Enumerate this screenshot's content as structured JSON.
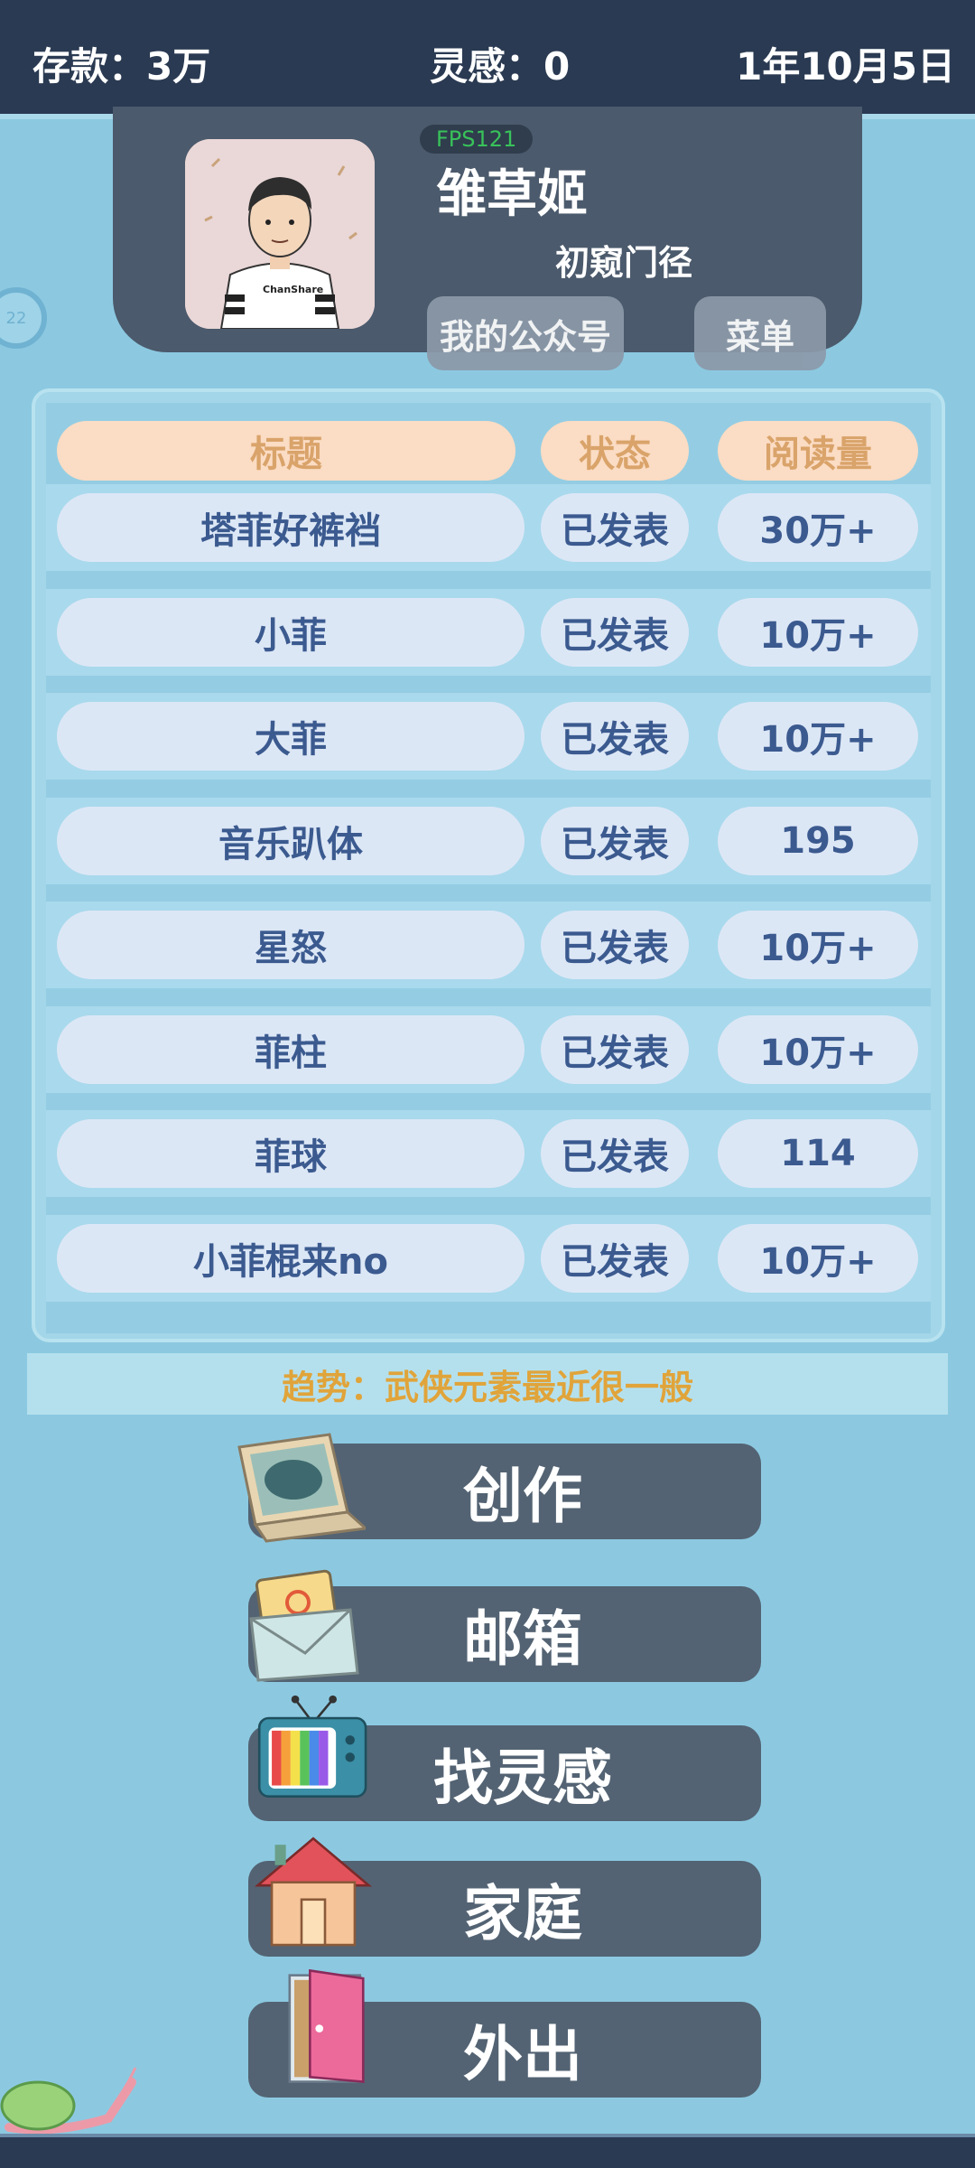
{
  "topbar": {
    "savings": "存款：3万",
    "inspiration": "灵感：0",
    "date": "1年10月5日"
  },
  "profile": {
    "fps": "FPS121",
    "name": "雏草姬",
    "level": "初窥门径",
    "avatar_shirt_text": "ChanShare",
    "buttons": {
      "account": "我的公众号",
      "menu": "菜单"
    }
  },
  "side_badge": "22",
  "table": {
    "headers": [
      "标题",
      "状态",
      "阅读量"
    ],
    "rows": [
      {
        "title": "塔菲好裤裆",
        "status": "已发表",
        "reads": "30万+"
      },
      {
        "title": "小菲",
        "status": "已发表",
        "reads": "10万+"
      },
      {
        "title": "大菲",
        "status": "已发表",
        "reads": "10万+"
      },
      {
        "title": "音乐趴体",
        "status": "已发表",
        "reads": "195"
      },
      {
        "title": "星怒",
        "status": "已发表",
        "reads": "10万+"
      },
      {
        "title": "菲柱",
        "status": "已发表",
        "reads": "10万+"
      },
      {
        "title": "菲球",
        "status": "已发表",
        "reads": "114"
      },
      {
        "title": "小菲棍来no",
        "status": "已发表",
        "reads": "10万+"
      }
    ]
  },
  "trend": "趋势：武侠元素最近很一般",
  "actions": [
    {
      "label": "创作",
      "icon": "laptop-icon"
    },
    {
      "label": "邮箱",
      "icon": "envelope-icon"
    },
    {
      "label": "找灵感",
      "icon": "tv-icon"
    },
    {
      "label": "家庭",
      "icon": "house-icon"
    },
    {
      "label": "外出",
      "icon": "door-icon"
    }
  ],
  "colors": {
    "background": "#8cc9e1",
    "topbar": "#2a3a52",
    "header_pill": "#fbdcc4",
    "cell": "#dce7f6",
    "cell_text": "#3b5a8f",
    "trend_text": "#e0a43a",
    "action_button": "#536373"
  }
}
